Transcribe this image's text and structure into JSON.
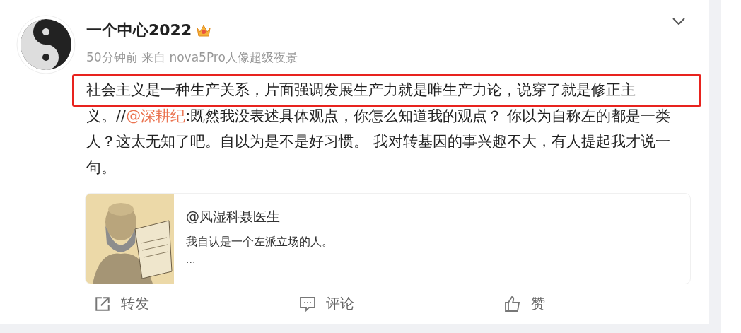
{
  "post": {
    "author": "一个中心2022",
    "meta": "50分钟前 来自 nova5Pro人像超级夜景",
    "highlighted": true,
    "segments": [
      {
        "kind": "text",
        "text": "社会主义是一种生产关系，片面强调发展生产力就是唯生产力论，说穿了就是修正主义。//"
      },
      {
        "kind": "mention",
        "text": "@深耕纪"
      },
      {
        "kind": "text",
        "text": ":既然我没表述具体观点，你怎么知道我的观点？ 你以为自称左的都是一类人？这太无知了吧。自以为是不是好习惯。 我对转基因的事兴趣不大，有人提起我才说一句。"
      }
    ],
    "quote": {
      "kind": "picture",
      "author": "@风湿科聂医生",
      "text": "我自认是一个左派立场的人。",
      "more": "..."
    },
    "actions": [
      {
        "kind": "repost",
        "label": "转发"
      },
      {
        "kind": "comment",
        "label": "评论"
      },
      {
        "kind": "like",
        "label": "赞"
      }
    ]
  }
}
